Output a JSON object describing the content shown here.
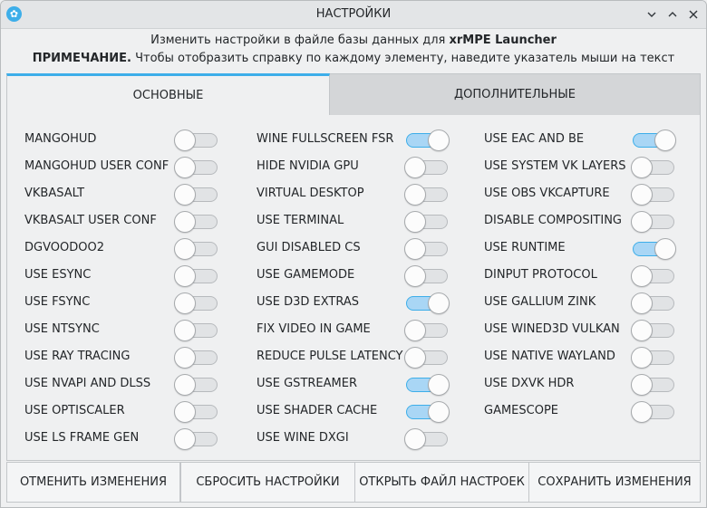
{
  "window": {
    "title": "НАСТРОЙКИ",
    "app_icon": "app-logo-icon",
    "controls": [
      "minimize-icon",
      "maximize-icon",
      "close-icon"
    ]
  },
  "info": {
    "line1_prefix": "Изменить настройки в файле базы данных для",
    "line1_app": "xrMPE Launcher",
    "note_label": "ПРИМЕЧАНИЕ.",
    "note_text": "Чтобы отобразить справку по каждому элементу, наведите указатель мыши на текст"
  },
  "tabs": [
    {
      "label": "ОСНОВНЫЕ",
      "active": true
    },
    {
      "label": "ДОПОЛНИТЕЛЬНЫЕ",
      "active": false
    }
  ],
  "accent_color": "#3daee9",
  "options": {
    "col1": [
      {
        "label": "MANGOHUD",
        "on": false
      },
      {
        "label": "MANGOHUD USER CONF",
        "on": false
      },
      {
        "label": "VKBASALT",
        "on": false
      },
      {
        "label": "VKBASALT USER CONF",
        "on": false
      },
      {
        "label": "DGVOODOO2",
        "on": false
      },
      {
        "label": "USE ESYNC",
        "on": false
      },
      {
        "label": "USE FSYNC",
        "on": false
      },
      {
        "label": "USE NTSYNC",
        "on": false
      },
      {
        "label": "USE RAY TRACING",
        "on": false
      },
      {
        "label": "USE NVAPI AND DLSS",
        "on": false
      },
      {
        "label": "USE OPTISCALER",
        "on": false
      },
      {
        "label": "USE LS FRAME GEN",
        "on": false
      }
    ],
    "col2": [
      {
        "label": "WINE FULLSCREEN FSR",
        "on": true
      },
      {
        "label": "HIDE NVIDIA GPU",
        "on": false
      },
      {
        "label": "VIRTUAL DESKTOP",
        "on": false
      },
      {
        "label": "USE TERMINAL",
        "on": false
      },
      {
        "label": "GUI DISABLED CS",
        "on": false
      },
      {
        "label": "USE GAMEMODE",
        "on": false
      },
      {
        "label": "USE D3D EXTRAS",
        "on": true
      },
      {
        "label": "FIX VIDEO IN GAME",
        "on": false
      },
      {
        "label": "REDUCE PULSE LATENCY",
        "on": false
      },
      {
        "label": "USE GSTREAMER",
        "on": true
      },
      {
        "label": "USE SHADER CACHE",
        "on": true
      },
      {
        "label": "USE WINE DXGI",
        "on": false
      }
    ],
    "col3": [
      {
        "label": "USE EAC AND BE",
        "on": true
      },
      {
        "label": "USE SYSTEM VK LAYERS",
        "on": false
      },
      {
        "label": "USE OBS VKCAPTURE",
        "on": false
      },
      {
        "label": "DISABLE COMPOSITING",
        "on": false
      },
      {
        "label": "USE RUNTIME",
        "on": true
      },
      {
        "label": "DINPUT PROTOCOL",
        "on": false
      },
      {
        "label": "USE GALLIUM ZINK",
        "on": false
      },
      {
        "label": "USE WINED3D VULKAN",
        "on": false
      },
      {
        "label": "USE NATIVE WAYLAND",
        "on": false
      },
      {
        "label": "USE DXVK HDR",
        "on": false
      },
      {
        "label": "GAMESCOPE",
        "on": false
      }
    ]
  },
  "buttons": [
    {
      "label": "ОТМЕНИТЬ ИЗМЕНЕНИЯ"
    },
    {
      "label": "СБРОСИТЬ НАСТРОЙКИ"
    },
    {
      "label": "ОТКРЫТЬ ФАЙЛ НАСТРОЕК"
    },
    {
      "label": "СОХРАНИТЬ ИЗМЕНЕНИЯ"
    }
  ]
}
